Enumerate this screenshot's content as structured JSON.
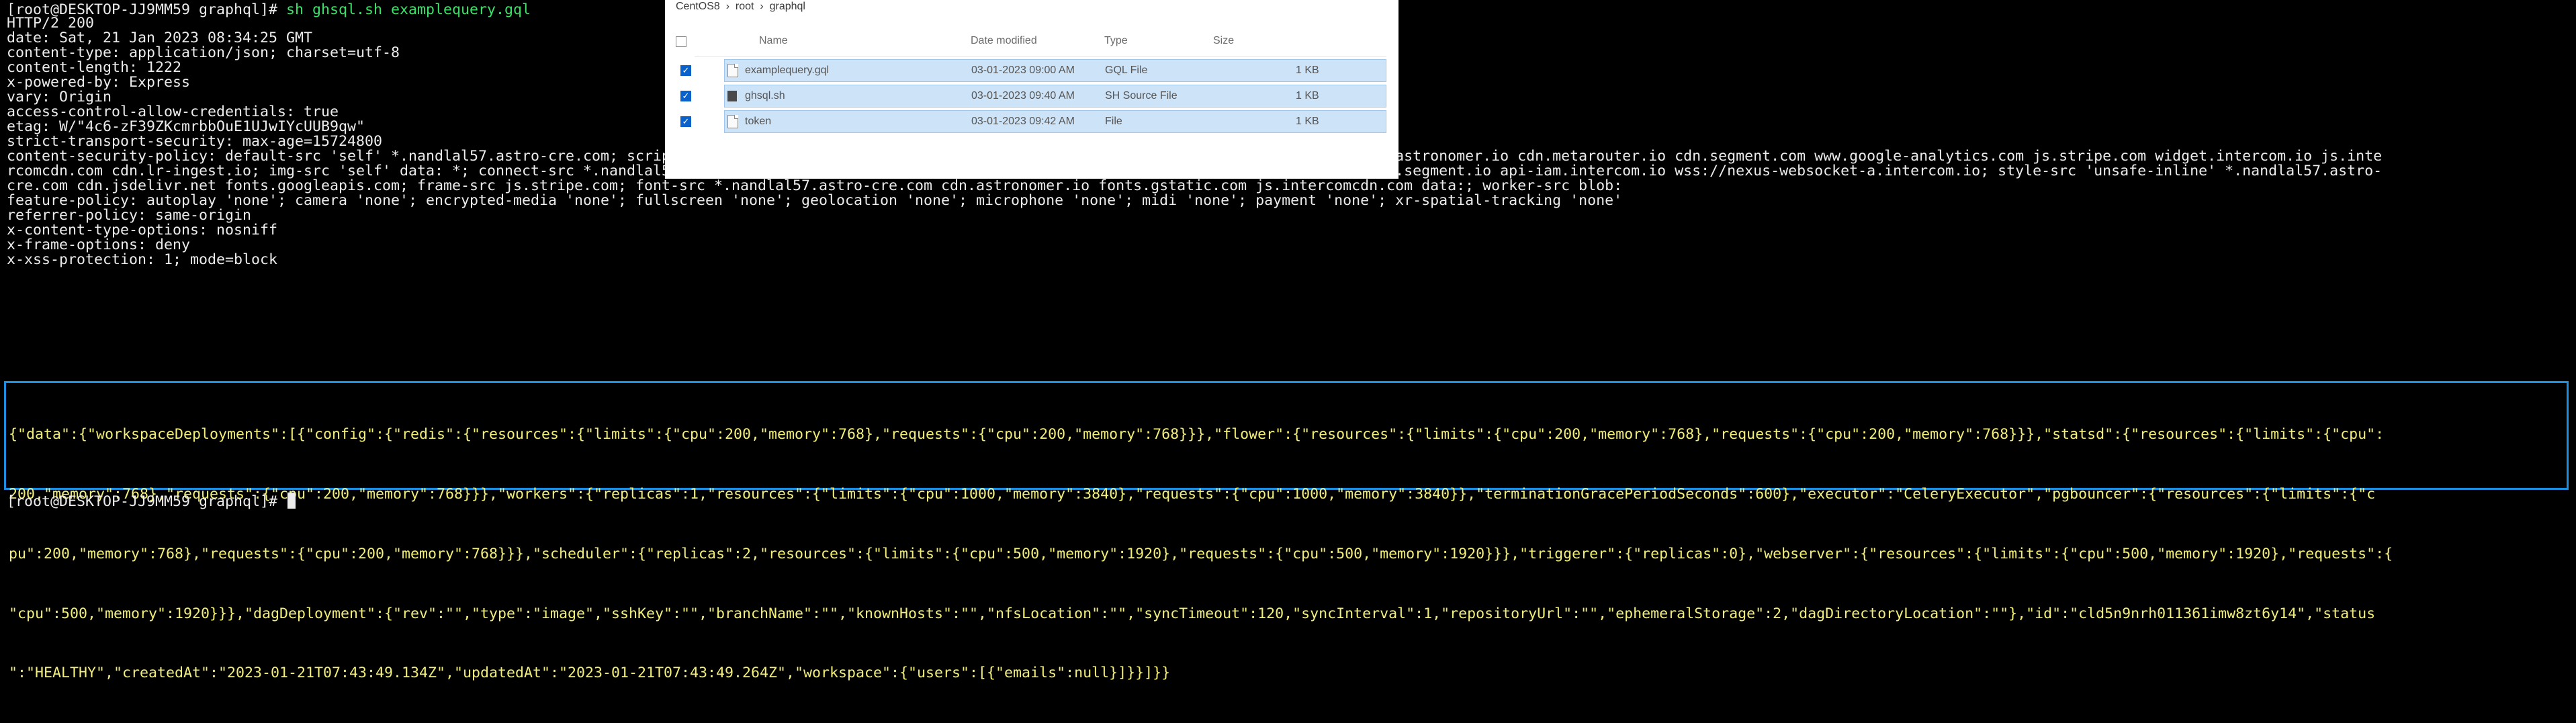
{
  "terminal": {
    "lines": [
      "[root@DESKTOP-JJ9MM59 graphql]# ",
      "HTTP/2 200",
      "date: Sat, 21 Jan 2023 08:34:25 GMT",
      "content-type: application/json; charset=utf-8",
      "content-length: 1222",
      "x-powered-by: Express",
      "vary: Origin",
      "access-control-allow-credentials: true",
      "etag: W/\"4c6-zF39ZKcmrbbOuE1UJwIYcUUB9qw\"",
      "strict-transport-security: max-age=15724800",
      "content-security-policy: default-src 'self' *.nandlal57.astro-cre.com; script-src 'unsafe-inline' 'unsafe-eval' *.nandlal57.astro-cre.com cdn.jsdelivr.net cdn.astronomer.io cdn.metarouter.io cdn.segment.com www.google-analytics.com js.stripe.com widget.intercom.io js.inte",
      "rcomcdn.com cdn.lr-ingest.io; img-src 'self' data: *; connect-src *.nandlal57.astro-cre.com wss://*.nandlal57.astro-cre.com e.metarouter.io api.segment.com api.segment.io api-iam.intercom.io wss://nexus-websocket-a.intercom.io; style-src 'unsafe-inline' *.nandlal57.astro-",
      "cre.com cdn.jsdelivr.net fonts.googleapis.com; frame-src js.stripe.com; font-src *.nandlal57.astro-cre.com cdn.astronomer.io fonts.gstatic.com js.intercomcdn.com data:; worker-src blob:",
      "feature-policy: autoplay 'none'; camera 'none'; encrypted-media 'none'; fullscreen 'none'; geolocation 'none'; microphone 'none'; midi 'none'; payment 'none'; xr-spatial-tracking 'none'",
      "referrer-policy: same-origin",
      "x-content-type-options: nosniff",
      "x-frame-options: deny",
      "x-xss-protection: 1; mode=block"
    ],
    "command": "sh ghsql.sh examplequery.gql",
    "json_lines": [
      "{\"data\":{\"workspaceDeployments\":[{\"config\":{\"redis\":{\"resources\":{\"limits\":{\"cpu\":200,\"memory\":768},\"requests\":{\"cpu\":200,\"memory\":768}}},\"flower\":{\"resources\":{\"limits\":{\"cpu\":200,\"memory\":768},\"requests\":{\"cpu\":200,\"memory\":768}}},\"statsd\":{\"resources\":{\"limits\":{\"cpu\":",
      "200,\"memory\":768},\"requests\":{\"cpu\":200,\"memory\":768}}},\"workers\":{\"replicas\":1,\"resources\":{\"limits\":{\"cpu\":1000,\"memory\":3840},\"requests\":{\"cpu\":1000,\"memory\":3840}},\"terminationGracePeriodSeconds\":600},\"executor\":\"CeleryExecutor\",\"pgbouncer\":{\"resources\":{\"limits\":{\"c",
      "pu\":200,\"memory\":768},\"requests\":{\"cpu\":200,\"memory\":768}}},\"scheduler\":{\"replicas\":2,\"resources\":{\"limits\":{\"cpu\":500,\"memory\":1920},\"requests\":{\"cpu\":500,\"memory\":1920}}},\"triggerer\":{\"replicas\":0},\"webserver\":{\"resources\":{\"limits\":{\"cpu\":500,\"memory\":1920},\"requests\":{",
      "\"cpu\":500,\"memory\":1920}}},\"dagDeployment\":{\"rev\":\"\",\"type\":\"image\",\"sshKey\":\"\",\"branchName\":\"\",\"knownHosts\":\"\",\"nfsLocation\":\"\",\"syncTimeout\":120,\"syncInterval\":1,\"repositoryUrl\":\"\",\"ephemeralStorage\":2,\"dagDirectoryLocation\":\"\"},\"id\":\"cld5n9nrh011361imw8zt6y14\",\"status",
      "\":\"HEALTHY\",\"createdAt\":\"2023-01-21T07:43:49.134Z\",\"updatedAt\":\"2023-01-21T07:43:49.264Z\",\"workspace\":{\"users\":[{\"emails\":null}]}}]}}"
    ],
    "final_prompt": "[root@DESKTOP-JJ9MM59 graphql]# "
  },
  "explorer": {
    "breadcrumb": "CentOS8  ›  root  ›  graphql",
    "columns": {
      "name": "Name",
      "date": "Date modified",
      "type": "Type",
      "size": "Size"
    },
    "files": [
      {
        "name": "examplequery.gql",
        "date": "03-01-2023 09:00 AM",
        "type": "GQL File",
        "size": "1 KB",
        "icon": "file-icon"
      },
      {
        "name": "ghsql.sh",
        "date": "03-01-2023 09:40 AM",
        "type": "SH Source File",
        "size": "1 KB",
        "icon": "sh-file-icon"
      },
      {
        "name": "token",
        "date": "03-01-2023 09:42 AM",
        "type": "File",
        "size": "1 KB",
        "icon": "file-icon"
      }
    ]
  },
  "colors": {
    "background": "#000000",
    "text": "#ececec",
    "command": "#3ee06a",
    "json": "#f2ee7a",
    "highlight_border": "#1e8fe0",
    "selected_row": "#cde3f8"
  }
}
